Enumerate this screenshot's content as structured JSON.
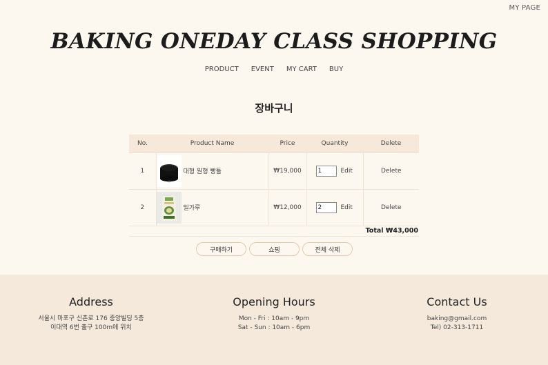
{
  "header": {
    "my_page": "MY PAGE",
    "title": "BAKING ONEDAY CLASS SHOPPING"
  },
  "nav": {
    "items": [
      {
        "label": "PRODUCT"
      },
      {
        "label": "EVENT"
      },
      {
        "label": "MY CART"
      },
      {
        "label": "BUY"
      }
    ]
  },
  "page_heading": "장바구니",
  "cart": {
    "columns": [
      "No.",
      "Product Name",
      "Price",
      "Quantity",
      "Delete"
    ],
    "rows": [
      {
        "no": "1",
        "name": "대형 원형 빵틀",
        "price": "₩19,000",
        "quantity": "1",
        "edit": "Edit",
        "delete": "Delete",
        "image": "round-baking-pan-image"
      },
      {
        "no": "2",
        "name": "밀가루",
        "price": "₩12,000",
        "quantity": "2",
        "edit": "Edit",
        "delete": "Delete",
        "image": "flour-bag-image"
      }
    ],
    "total": "Total ₩43,000"
  },
  "actions": {
    "buy": "구매하기",
    "shopping": "쇼핑",
    "delete_all": "전체 삭제"
  },
  "footer": {
    "address": {
      "title": "Address",
      "line1": "서울시 마포구 신촌로 176 중앙빌딩 5층",
      "line2": "이대역 6번 출구 100m에 위치"
    },
    "hours": {
      "title": "Opening Hours",
      "line1": "Mon - Fri : 10am - 9pm",
      "line2": "Sat - Sun : 10am - 6pm"
    },
    "contact": {
      "title": "Contact Us",
      "line1": "baking@gmail.com",
      "line2": "Tel) 02-313-1711"
    }
  },
  "colors": {
    "background": "#fcf8ef",
    "table_header": "#f7e9da",
    "footer": "#f5e9db",
    "button_border": "#e6c9a8"
  }
}
